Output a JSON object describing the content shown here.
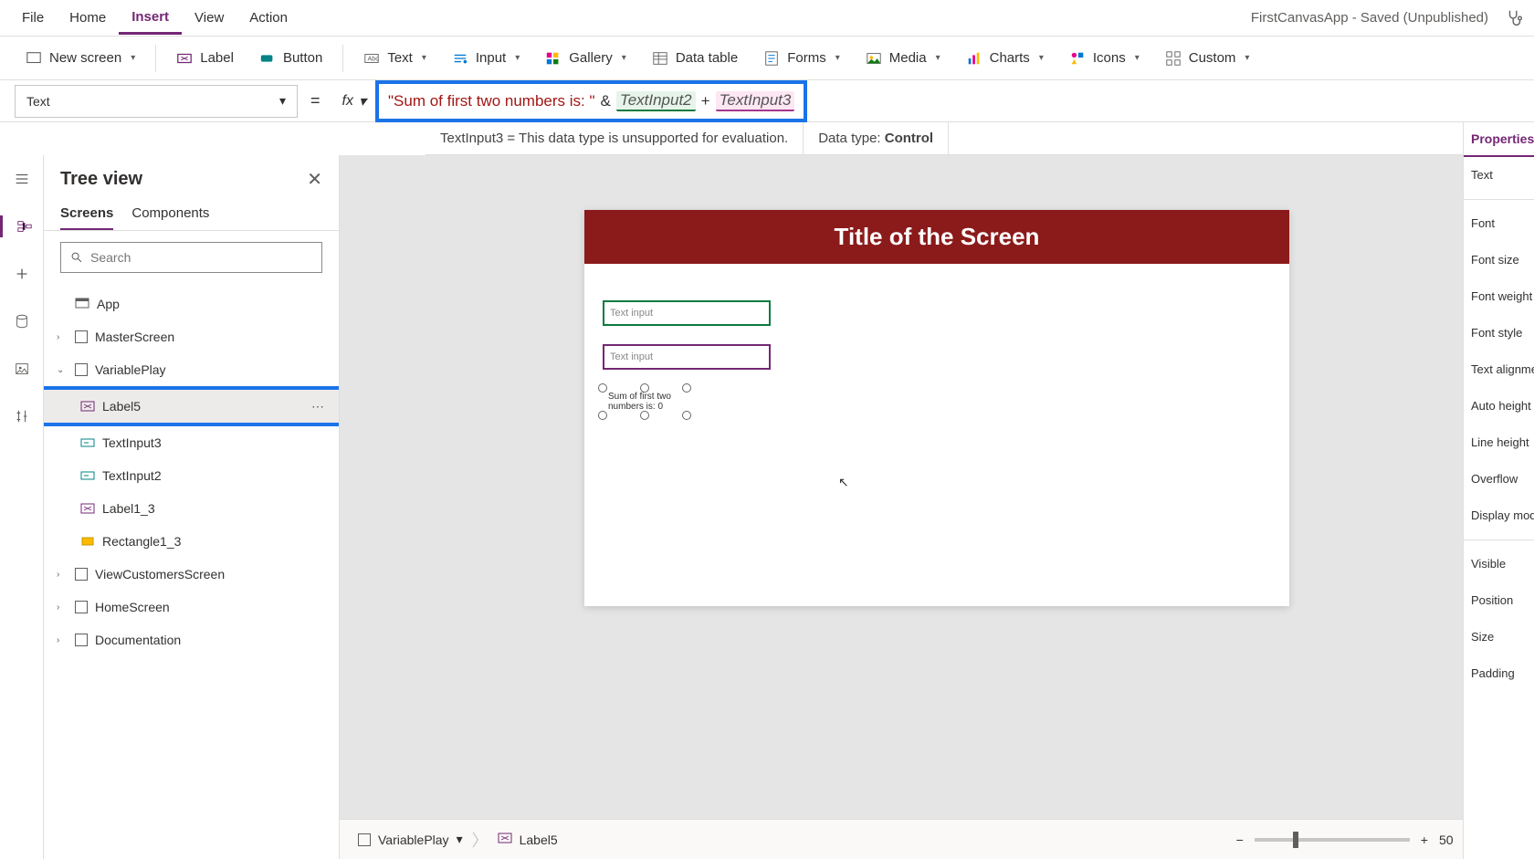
{
  "menubar": {
    "items": [
      "File",
      "Home",
      "Insert",
      "View",
      "Action"
    ],
    "active_index": 2,
    "app_title": "FirstCanvasApp - Saved (Unpublished)"
  },
  "ribbon": {
    "new_screen": "New screen",
    "label": "Label",
    "button": "Button",
    "text": "Text",
    "input": "Input",
    "gallery": "Gallery",
    "data_table": "Data table",
    "forms": "Forms",
    "media": "Media",
    "charts": "Charts",
    "icons": "Icons",
    "custom": "Custom"
  },
  "formula": {
    "property": "Text",
    "eq": "=",
    "fx": "fx",
    "string_part": "\"Sum of first two numbers is: \"",
    "amp": "&",
    "token1": "TextInput2",
    "plus": "+",
    "token2": "TextInput3"
  },
  "result": {
    "left": "TextInput3  =  This data type is unsupported for evaluation.",
    "datatype_label": "Data type:",
    "datatype_value": "Control"
  },
  "tooltip": "TextInput3",
  "tree": {
    "title": "Tree view",
    "tabs": [
      "Screens",
      "Components"
    ],
    "active_tab": 0,
    "search_placeholder": "Search",
    "items": [
      {
        "label": "App",
        "type": "app",
        "expand": ""
      },
      {
        "label": "MasterScreen",
        "type": "screen",
        "expand": "›"
      },
      {
        "label": "VariablePlay",
        "type": "screen",
        "expand": "⌄"
      },
      {
        "label": "Label5",
        "type": "label",
        "indent": 1,
        "selected": true,
        "highlighted": true,
        "more": true
      },
      {
        "label": "TextInput3",
        "type": "textinput",
        "indent": 1
      },
      {
        "label": "TextInput2",
        "type": "textinput",
        "indent": 1
      },
      {
        "label": "Label1_3",
        "type": "label",
        "indent": 1
      },
      {
        "label": "Rectangle1_3",
        "type": "rect",
        "indent": 1
      },
      {
        "label": "ViewCustomersScreen",
        "type": "screen",
        "expand": "›"
      },
      {
        "label": "HomeScreen",
        "type": "screen",
        "expand": "›"
      },
      {
        "label": "Documentation",
        "type": "screen",
        "expand": "›"
      }
    ]
  },
  "canvas": {
    "screen_title": "Title of the Screen",
    "textinput_placeholder": "Text input",
    "label_text": "Sum of first two numbers is: 0"
  },
  "breadcrumb": {
    "screen": "VariablePlay",
    "control": "Label5",
    "zoom_minus": "−",
    "zoom_plus": "+",
    "zoom_value": "50",
    "zoom_pct": "%"
  },
  "properties": {
    "tab": "Properties",
    "rows": [
      "Text",
      "Font",
      "Font size",
      "Font weight",
      "Font style",
      "Text alignment",
      "Auto height",
      "Line height",
      "Overflow",
      "Display mode",
      "Visible",
      "Position",
      "Size",
      "Padding"
    ]
  }
}
